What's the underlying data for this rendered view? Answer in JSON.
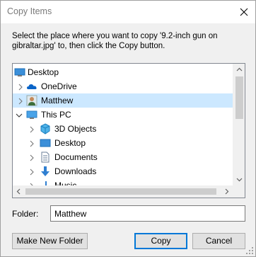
{
  "window": {
    "title": "Copy Items"
  },
  "instruction": "Select the place where you want to copy '9.2-inch gun on gibraltar.jpg' to, then click the Copy button.",
  "tree": {
    "items": [
      {
        "label": "Desktop",
        "icon": "desktop-icon",
        "expander": "none",
        "selected": false
      },
      {
        "label": "OneDrive",
        "icon": "onedrive-icon",
        "expander": "collapsed",
        "selected": false
      },
      {
        "label": "Matthew",
        "icon": "user-icon",
        "expander": "collapsed",
        "selected": true
      },
      {
        "label": "This PC",
        "icon": "this-pc-icon",
        "expander": "expanded",
        "selected": false
      },
      {
        "label": "3D Objects",
        "icon": "3d-objects-icon",
        "expander": "collapsed",
        "selected": false
      },
      {
        "label": "Desktop",
        "icon": "desktop-icon",
        "expander": "collapsed",
        "selected": false
      },
      {
        "label": "Documents",
        "icon": "documents-icon",
        "expander": "collapsed",
        "selected": false
      },
      {
        "label": "Downloads",
        "icon": "downloads-icon",
        "expander": "collapsed",
        "selected": false
      },
      {
        "label": "Music",
        "icon": "music-icon",
        "expander": "collapsed",
        "selected": false
      }
    ]
  },
  "folder": {
    "label": "Folder:",
    "value": "Matthew"
  },
  "buttons": {
    "make_new_folder": "Make New Folder",
    "copy": "Copy",
    "cancel": "Cancel"
  },
  "colors": {
    "selection": "#cce8ff",
    "accent": "#0078d7",
    "dialog_bg": "#f0f0f0"
  }
}
